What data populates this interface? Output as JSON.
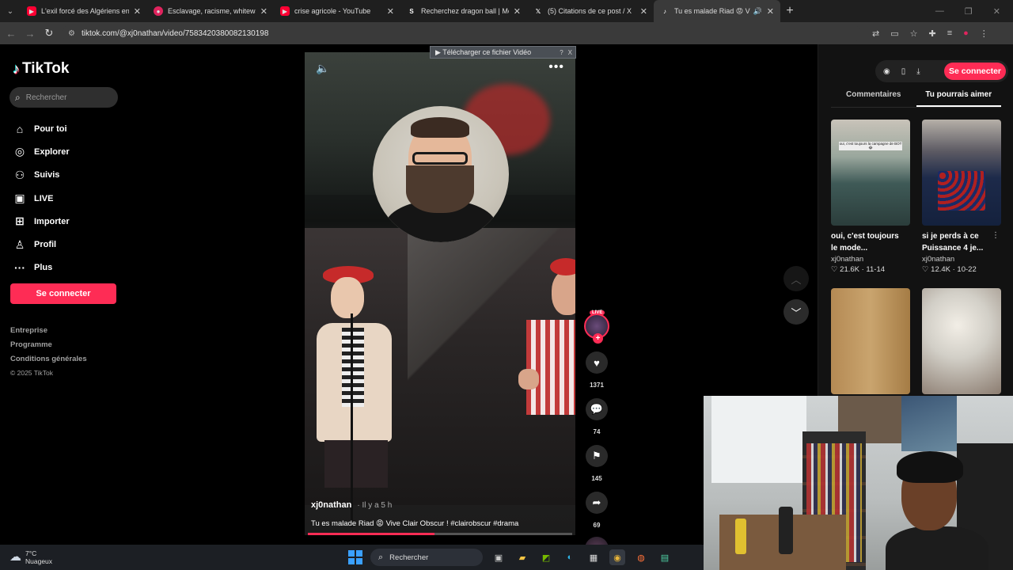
{
  "browser": {
    "tabs": [
      {
        "title": "L'exil forcé des Algériens en No",
        "favicon": "youtube-icon",
        "color": "#ff0033"
      },
      {
        "title": "Esclavage, racisme, whitewashin",
        "favicon": "record-icon",
        "color": "#e0245e"
      },
      {
        "title": "crise agricole - YouTube",
        "favicon": "youtube-icon",
        "color": "#ff0033"
      },
      {
        "title": "Recherchez dragon ball | Mode",
        "favicon": "s-icon",
        "color": "#ffffff"
      },
      {
        "title": "(5) Citations de ce post / X",
        "favicon": "x-icon",
        "color": "#ffffff"
      },
      {
        "title": "Tu es malade Riad 😡 Vive",
        "favicon": "tiktok-icon",
        "color": "#ffffff"
      }
    ],
    "url": "tiktok.com/@xj0nathan/video/7583420380082130198"
  },
  "download_banner": {
    "label": "▶ Télécharger ce fichier Vidéo",
    "help": "?",
    "close": "X"
  },
  "sidebar": {
    "logo": "TikTok",
    "search_placeholder": "Rechercher",
    "nav": [
      {
        "label": "Pour toi",
        "icon": "home-icon"
      },
      {
        "label": "Explorer",
        "icon": "compass-icon"
      },
      {
        "label": "Suivis",
        "icon": "following-icon"
      },
      {
        "label": "LIVE",
        "icon": "live-icon"
      },
      {
        "label": "Importer",
        "icon": "upload-icon"
      },
      {
        "label": "Profil",
        "icon": "profile-icon"
      },
      {
        "label": "Plus",
        "icon": "more-icon"
      }
    ],
    "connect": "Se connecter",
    "footer": [
      "Entreprise",
      "Programme",
      "Conditions générales"
    ],
    "copyright": "© 2025 TikTok"
  },
  "video": {
    "author": "xj0nathan",
    "ago": "· Il y a 5 h",
    "caption": "Tu es malade Riad 😡 Vive Clair Obscur ! #clairobscur #drama",
    "progress": 0.48
  },
  "actions": {
    "live_badge": "LIVE",
    "likes": "1371",
    "comments": "74",
    "saves": "145",
    "shares": "69"
  },
  "right_panel": {
    "connect": "Se connecter",
    "tabs": [
      "Commentaires",
      "Tu pourrais aimer"
    ],
    "active_tab": 1,
    "cards": [
      {
        "title": "oui, c'est toujours le mode...",
        "author": "xj0nathan",
        "stats": "♡ 21.6K · 11-14",
        "overlay": "oui, c'est toujours la campagne de BOT 😂"
      },
      {
        "title": "si je perds à ce Puissance 4 je...",
        "author": "xj0nathan",
        "stats": "♡ 12.4K · 10-22",
        "overlay": ""
      },
      {
        "title": "",
        "author": "",
        "stats": "",
        "overlay": ""
      },
      {
        "title": "",
        "author": "",
        "stats": "",
        "overlay": ""
      }
    ]
  },
  "taskbar": {
    "temp": "7°C",
    "weather": "Nuageux",
    "search": "Rechercher"
  },
  "colors": {
    "accent": "#fe2c55"
  }
}
